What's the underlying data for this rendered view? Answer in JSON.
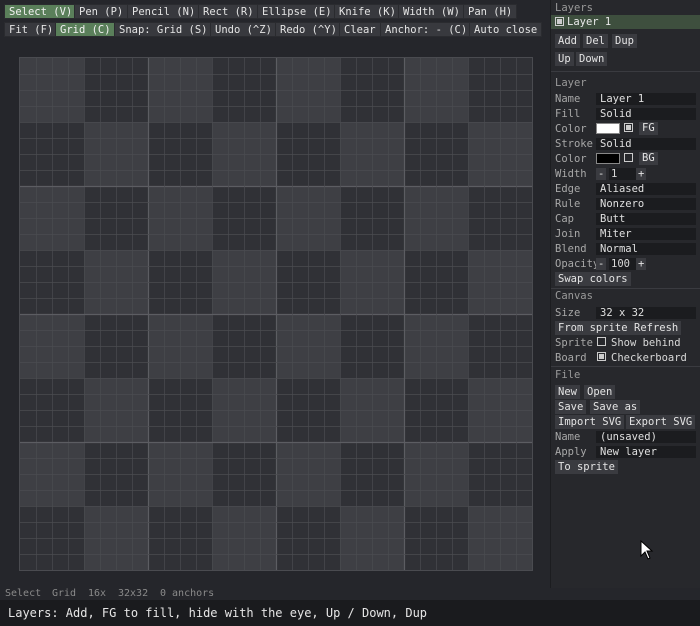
{
  "toolbar": {
    "row1": [
      {
        "label": "Select (V)",
        "active": true
      },
      {
        "label": "Pen (P)"
      },
      {
        "label": "Pencil (N)"
      },
      {
        "label": "Rect (R)"
      },
      {
        "label": "Ellipse (E)"
      },
      {
        "label": "Knife (K)"
      },
      {
        "label": "Width (W)"
      },
      {
        "label": "Pan (H)"
      }
    ],
    "row2": [
      {
        "label": "Fit (F)"
      },
      {
        "label": "Grid (C)",
        "active": true
      },
      {
        "label": "Snap: Grid (S)"
      },
      {
        "label": "Undo (^Z)"
      },
      {
        "label": "Redo (^Y)"
      },
      {
        "label": "Clear"
      },
      {
        "label": "Anchor: - (C)"
      },
      {
        "label": "Auto close"
      }
    ]
  },
  "canvas": {
    "size": "32 x 32",
    "checker_light": "#3e3f44",
    "checker_dark": "#303136",
    "grid_fine": "#4b4c51",
    "grid_major": "#5c5d62"
  },
  "layers": {
    "title": "Layers",
    "items": [
      {
        "name": "Layer 1",
        "visible": true,
        "selected": true
      }
    ],
    "add": "Add",
    "del": "Del",
    "dup": "Dup",
    "up": "Up",
    "down": "Down"
  },
  "layer": {
    "title": "Layer",
    "name_label": "Name",
    "name_value": "Layer 1",
    "fill_label": "Fill",
    "fill_value": "Solid",
    "fill_color_label": "Color",
    "fill_color": "#ffffff",
    "fill_tag": "FG",
    "stroke_label": "Stroke",
    "stroke_value": "Solid",
    "stroke_color_label": "Color",
    "stroke_color": "#000000",
    "stroke_tag": "BG",
    "width_label": "Width",
    "width_minus": "-",
    "width_value": "1",
    "width_plus": "+",
    "edge_label": "Edge",
    "edge_value": "Aliased",
    "rule_label": "Rule",
    "rule_value": "Nonzero",
    "cap_label": "Cap",
    "cap_value": "Butt",
    "join_label": "Join",
    "join_value": "Miter",
    "blend_label": "Blend",
    "blend_value": "Normal",
    "opacity_label": "Opacity",
    "opacity_minus": "-",
    "opacity_value": "100",
    "opacity_plus": "+",
    "swap": "Swap colors"
  },
  "canvas_panel": {
    "title": "Canvas",
    "size_label": "Size",
    "size_value": "32 x 32",
    "from_sprite": "From sprite",
    "refresh": "Refresh",
    "sprite_label": "Sprite",
    "show_behind": "Show behind",
    "show_behind_checked": false,
    "board_label": "Board",
    "checkerboard": "Checkerboard",
    "checkerboard_checked": true
  },
  "file": {
    "title": "File",
    "new": "New",
    "open": "Open",
    "save": "Save",
    "save_as": "Save as",
    "import_svg": "Import SVG",
    "export_svg": "Export SVG",
    "name_label": "Name",
    "name_value": "(unsaved)",
    "apply_label": "Apply",
    "apply_value": "New layer",
    "to_sprite": "To sprite"
  },
  "status": {
    "tool": "Select",
    "grid": "Grid",
    "zoom": "16x",
    "size": "32x32",
    "anchors": "0 anchors"
  },
  "hint": "Layers: Add, FG to fill, hide with the eye, Up / Down, Dup"
}
